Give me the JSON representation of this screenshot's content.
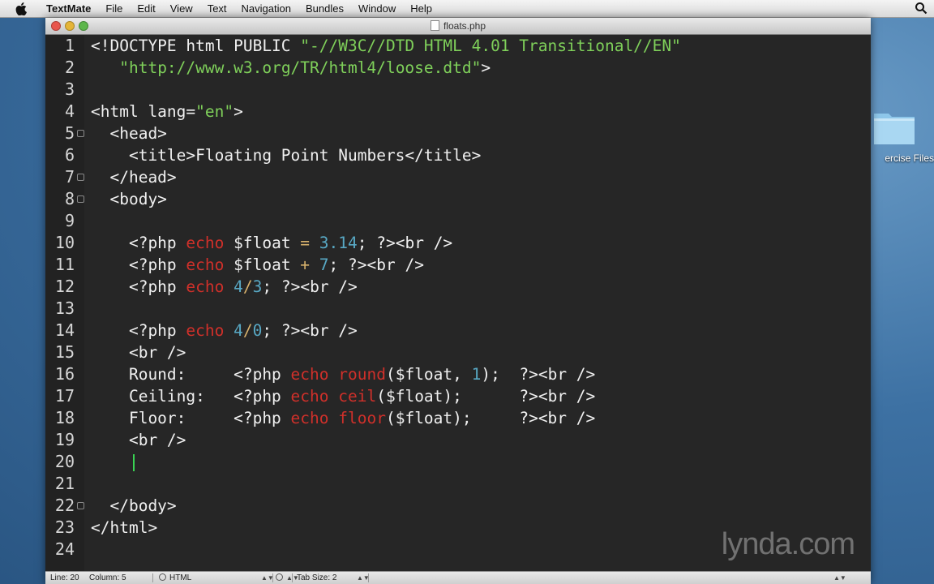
{
  "menubar": {
    "items": [
      "TextMate",
      "File",
      "Edit",
      "View",
      "Text",
      "Navigation",
      "Bundles",
      "Window",
      "Help"
    ],
    "apple_icon": "apple-logo-icon",
    "right_icon": "spotlight-search-icon"
  },
  "desktop": {
    "folder_label": "ercise Files"
  },
  "window": {
    "title": "floats.php"
  },
  "editor": {
    "colors": {
      "background": "#262626",
      "text": "#f0f0f0",
      "keyword": "#d0302a",
      "string": "#7fd05a",
      "number": "#58a8c4",
      "operator": "#d7b16c",
      "cursor": "#39d353"
    },
    "lines": [
      {
        "num": "1",
        "fold": false,
        "segs": [
          {
            "t": "<!DOCTYPE html PUBLIC ",
            "c": "#f0f0f0"
          },
          {
            "t": "\"-//W3C//DTD HTML 4.01 Transitional//EN\"",
            "c": "#7fd05a"
          }
        ]
      },
      {
        "num": "2",
        "fold": false,
        "segs": [
          {
            "t": "   ",
            "c": "#f0f0f0"
          },
          {
            "t": "\"http://www.w3.org/TR/html4/loose.dtd\"",
            "c": "#7fd05a"
          },
          {
            "t": ">",
            "c": "#f0f0f0"
          }
        ]
      },
      {
        "num": "3",
        "fold": false,
        "segs": []
      },
      {
        "num": "4",
        "fold": false,
        "segs": [
          {
            "t": "<html lang=",
            "c": "#f0f0f0"
          },
          {
            "t": "\"en\"",
            "c": "#7fd05a"
          },
          {
            "t": ">",
            "c": "#f0f0f0"
          }
        ]
      },
      {
        "num": "5",
        "fold": true,
        "segs": [
          {
            "t": "  <head>",
            "c": "#f0f0f0"
          }
        ]
      },
      {
        "num": "6",
        "fold": false,
        "segs": [
          {
            "t": "    <title>Floating Point Numbers</title>",
            "c": "#f0f0f0"
          }
        ]
      },
      {
        "num": "7",
        "fold": true,
        "segs": [
          {
            "t": "  </head>",
            "c": "#f0f0f0"
          }
        ]
      },
      {
        "num": "8",
        "fold": true,
        "segs": [
          {
            "t": "  <body>",
            "c": "#f0f0f0"
          }
        ]
      },
      {
        "num": "9",
        "fold": false,
        "segs": []
      },
      {
        "num": "10",
        "fold": false,
        "segs": [
          {
            "t": "    <?php ",
            "c": "#f0f0f0"
          },
          {
            "t": "echo",
            "c": "#d0302a"
          },
          {
            "t": " $float ",
            "c": "#f0f0f0"
          },
          {
            "t": "=",
            "c": "#d7b16c"
          },
          {
            "t": " ",
            "c": "#f0f0f0"
          },
          {
            "t": "3.14",
            "c": "#58a8c4"
          },
          {
            "t": "; ?>",
            "c": "#f0f0f0"
          },
          {
            "t": "<br />",
            "c": "#f0f0f0"
          }
        ]
      },
      {
        "num": "11",
        "fold": false,
        "segs": [
          {
            "t": "    <?php ",
            "c": "#f0f0f0"
          },
          {
            "t": "echo",
            "c": "#d0302a"
          },
          {
            "t": " $float ",
            "c": "#f0f0f0"
          },
          {
            "t": "+",
            "c": "#d7b16c"
          },
          {
            "t": " ",
            "c": "#f0f0f0"
          },
          {
            "t": "7",
            "c": "#58a8c4"
          },
          {
            "t": "; ?>",
            "c": "#f0f0f0"
          },
          {
            "t": "<br />",
            "c": "#f0f0f0"
          }
        ]
      },
      {
        "num": "12",
        "fold": false,
        "segs": [
          {
            "t": "    <?php ",
            "c": "#f0f0f0"
          },
          {
            "t": "echo",
            "c": "#d0302a"
          },
          {
            "t": " ",
            "c": "#f0f0f0"
          },
          {
            "t": "4",
            "c": "#58a8c4"
          },
          {
            "t": "/",
            "c": "#d7b16c"
          },
          {
            "t": "3",
            "c": "#58a8c4"
          },
          {
            "t": "; ?>",
            "c": "#f0f0f0"
          },
          {
            "t": "<br />",
            "c": "#f0f0f0"
          }
        ]
      },
      {
        "num": "13",
        "fold": false,
        "segs": []
      },
      {
        "num": "14",
        "fold": false,
        "segs": [
          {
            "t": "    <?php ",
            "c": "#f0f0f0"
          },
          {
            "t": "echo",
            "c": "#d0302a"
          },
          {
            "t": " ",
            "c": "#f0f0f0"
          },
          {
            "t": "4",
            "c": "#58a8c4"
          },
          {
            "t": "/",
            "c": "#d7b16c"
          },
          {
            "t": "0",
            "c": "#58a8c4"
          },
          {
            "t": "; ?>",
            "c": "#f0f0f0"
          },
          {
            "t": "<br />",
            "c": "#f0f0f0"
          }
        ]
      },
      {
        "num": "15",
        "fold": false,
        "segs": [
          {
            "t": "    <br />",
            "c": "#f0f0f0"
          }
        ]
      },
      {
        "num": "16",
        "fold": false,
        "segs": [
          {
            "t": "    Round:     <?php ",
            "c": "#f0f0f0"
          },
          {
            "t": "echo",
            "c": "#d0302a"
          },
          {
            "t": " ",
            "c": "#f0f0f0"
          },
          {
            "t": "round",
            "c": "#d0302a"
          },
          {
            "t": "($float, ",
            "c": "#f0f0f0"
          },
          {
            "t": "1",
            "c": "#58a8c4"
          },
          {
            "t": ");  ?>",
            "c": "#f0f0f0"
          },
          {
            "t": "<br />",
            "c": "#f0f0f0"
          }
        ]
      },
      {
        "num": "17",
        "fold": false,
        "segs": [
          {
            "t": "    Ceiling:   <?php ",
            "c": "#f0f0f0"
          },
          {
            "t": "echo",
            "c": "#d0302a"
          },
          {
            "t": " ",
            "c": "#f0f0f0"
          },
          {
            "t": "ceil",
            "c": "#d0302a"
          },
          {
            "t": "($float);      ?>",
            "c": "#f0f0f0"
          },
          {
            "t": "<br />",
            "c": "#f0f0f0"
          }
        ]
      },
      {
        "num": "18",
        "fold": false,
        "segs": [
          {
            "t": "    Floor:     <?php ",
            "c": "#f0f0f0"
          },
          {
            "t": "echo",
            "c": "#d0302a"
          },
          {
            "t": " ",
            "c": "#f0f0f0"
          },
          {
            "t": "floor",
            "c": "#d0302a"
          },
          {
            "t": "($float);     ?>",
            "c": "#f0f0f0"
          },
          {
            "t": "<br />",
            "c": "#f0f0f0"
          }
        ]
      },
      {
        "num": "19",
        "fold": false,
        "segs": [
          {
            "t": "    <br />",
            "c": "#f0f0f0"
          }
        ]
      },
      {
        "num": "20",
        "fold": false,
        "segs": []
      },
      {
        "num": "21",
        "fold": false,
        "segs": []
      },
      {
        "num": "22",
        "fold": true,
        "segs": [
          {
            "t": "  </body>",
            "c": "#f0f0f0"
          }
        ]
      },
      {
        "num": "23",
        "fold": false,
        "segs": [
          {
            "t": "</html>",
            "c": "#f0f0f0"
          }
        ]
      },
      {
        "num": "24",
        "fold": false,
        "segs": []
      }
    ],
    "cursor_line": "20",
    "watermark": "lynda.com"
  },
  "statusbar": {
    "line": "Line: 20",
    "column": "Column: 5",
    "language": "HTML",
    "tab_size": "Tab Size:  2"
  }
}
